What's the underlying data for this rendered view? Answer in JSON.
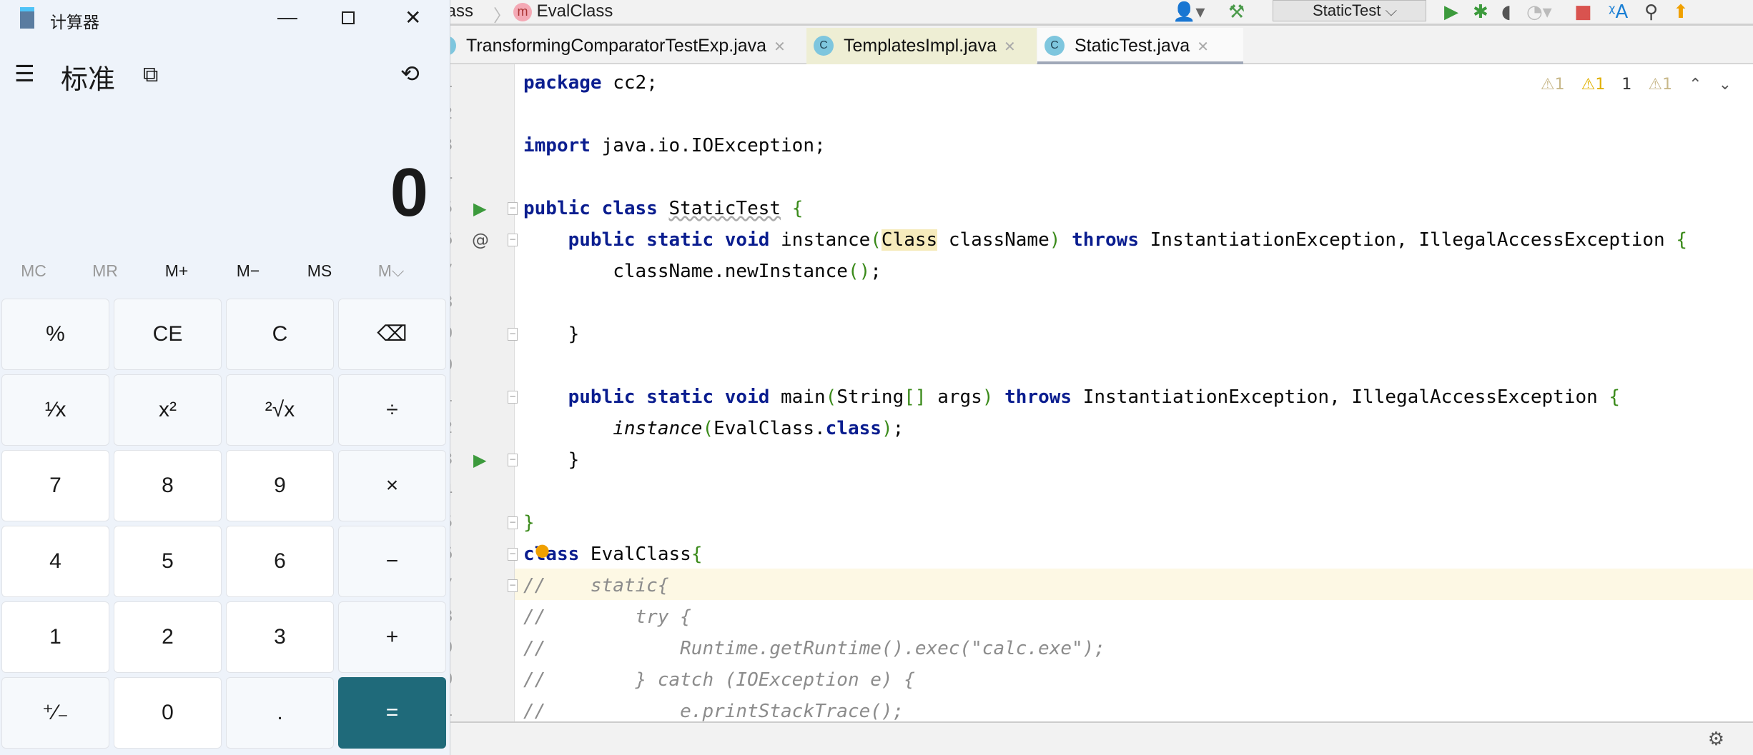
{
  "ide": {
    "breadcrumb": [
      "Class",
      "EvalClass"
    ],
    "run_config": "StaticTest",
    "tabs": [
      {
        "label": "TransformingComparatorTestExp.java"
      },
      {
        "label": "TemplatesImpl.java"
      },
      {
        "label": "StaticTest.java",
        "active": true
      }
    ],
    "inspections": [
      "⚠1",
      "⚠1",
      "1",
      "⚠1"
    ],
    "line_numbers": [
      "1",
      "2",
      "3",
      "4",
      "5",
      "6",
      "7",
      "8",
      "9",
      "0",
      "1",
      "2",
      "3",
      "4",
      "5",
      "6",
      "7",
      "8",
      "9",
      "0",
      "1"
    ],
    "code": [
      [
        [
          "package",
          "kw"
        ],
        [
          " cc2;",
          ""
        ]
      ],
      [],
      [
        [
          "import",
          "kw"
        ],
        [
          " java.io.IOException;",
          ""
        ]
      ],
      [],
      [
        [
          "public class",
          "kw"
        ],
        [
          " ",
          ""
        ],
        [
          "StaticTest",
          "wav"
        ],
        [
          " ",
          ""
        ],
        [
          "{",
          "br"
        ]
      ],
      [
        [
          "    public static void",
          "kw"
        ],
        [
          " instance",
          ""
        ],
        [
          "(",
          "br"
        ],
        [
          "Class",
          "sel"
        ],
        [
          " className",
          ""
        ],
        [
          ")",
          "br"
        ],
        [
          " ",
          ""
        ],
        [
          "throws",
          "kw"
        ],
        [
          " InstantiationException, IllegalAccessException ",
          ""
        ],
        [
          "{",
          "br"
        ]
      ],
      [
        [
          "        className.newInstance",
          ""
        ],
        [
          "()",
          "br"
        ],
        [
          ";",
          ""
        ]
      ],
      [],
      [
        [
          "    }",
          ""
        ]
      ],
      [],
      [
        [
          "    public static void",
          "kw"
        ],
        [
          " main",
          ""
        ],
        [
          "(",
          "br"
        ],
        [
          "String",
          ""
        ],
        [
          "[]",
          "br"
        ],
        [
          " args",
          ""
        ],
        [
          ")",
          "br"
        ],
        [
          " ",
          ""
        ],
        [
          "throws",
          "kw"
        ],
        [
          " InstantiationException, IllegalAccessException ",
          ""
        ],
        [
          "{",
          "br"
        ]
      ],
      [
        [
          "        ",
          ""
        ],
        [
          "instance",
          "it"
        ],
        [
          "(",
          "br"
        ],
        [
          "EvalClass.",
          ""
        ],
        [
          "class",
          "kw"
        ],
        [
          ")",
          "br"
        ],
        [
          ";",
          ""
        ]
      ],
      [
        [
          "    }",
          ""
        ]
      ],
      [],
      [
        [
          "}",
          "br"
        ]
      ],
      [
        [
          "class",
          "kw"
        ],
        [
          " EvalClass",
          ""
        ],
        [
          "{",
          "br"
        ]
      ],
      [
        [
          "//    static{",
          "cm"
        ]
      ],
      [
        [
          "//        try {",
          "cm"
        ]
      ],
      [
        [
          "//            Runtime.getRuntime().exec(\"calc.exe\");",
          "cm"
        ]
      ],
      [
        [
          "//        } catch (IOException e) {",
          "cm"
        ]
      ],
      [
        [
          "//            e.printStackTrace();",
          "cm"
        ]
      ]
    ]
  },
  "calc": {
    "title": "计算器",
    "mode": "标准",
    "display": "0",
    "memory": [
      "MC",
      "MR",
      "M+",
      "M−",
      "MS",
      "M⌵"
    ],
    "keys": [
      "%",
      "CE",
      "C",
      "⌫",
      "¹⁄x",
      "x²",
      "²√x",
      "÷",
      "7",
      "8",
      "9",
      "×",
      "4",
      "5",
      "6",
      "−",
      "1",
      "2",
      "3",
      "+",
      "⁺⁄₋",
      "0",
      ".",
      "="
    ],
    "accent": "#1f6a7a"
  }
}
